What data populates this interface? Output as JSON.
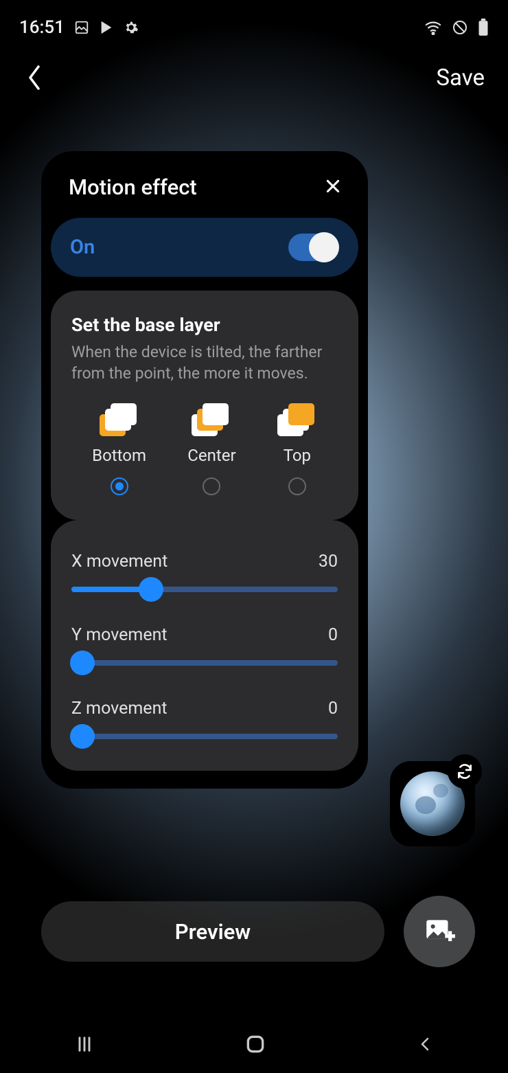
{
  "status": {
    "time": "16:51"
  },
  "appbar": {
    "save": "Save"
  },
  "dialog": {
    "title": "Motion effect",
    "toggle_label": "On",
    "base": {
      "title": "Set the base layer",
      "desc": "When the device is tilted, the farther from the point, the more it moves.",
      "options": [
        {
          "label": "Bottom"
        },
        {
          "label": "Center"
        },
        {
          "label": "Top"
        }
      ]
    },
    "sliders": {
      "x": {
        "label": "X movement",
        "value": "30",
        "pct": 30
      },
      "y": {
        "label": "Y movement",
        "value": "0",
        "pct": 0
      },
      "z": {
        "label": "Z movement",
        "value": "0",
        "pct": 0
      }
    }
  },
  "bottom": {
    "preview": "Preview"
  }
}
